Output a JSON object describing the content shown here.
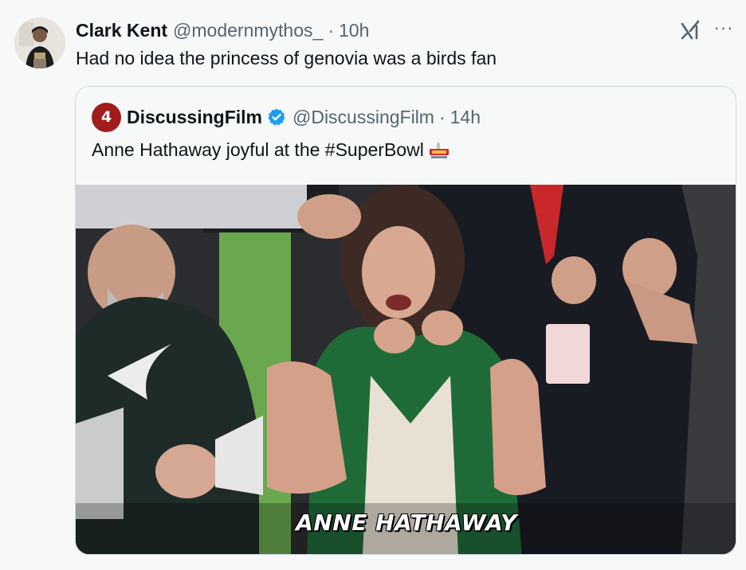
{
  "tweet": {
    "author_name": "Clark Kent",
    "author_handle": "@modernmythos_",
    "separator": "·",
    "time": "10h",
    "text": "Had no idea the princess of genovia was a birds fan",
    "more_label": "···"
  },
  "quote": {
    "avatar_text": "4",
    "author_name": "DiscussingFilm",
    "author_handle": "@DiscussingFilm",
    "separator": "·",
    "time": "14h",
    "text": "Anne Hathaway joyful at the #SuperBowl",
    "media_caption": "ANNE HATHAWAY"
  },
  "icons": {
    "grok": "grok-icon",
    "more": "more-icon",
    "verified": "verified-badge-icon",
    "superbowl": "super-bowl-lix-logo"
  },
  "colors": {
    "background": "#f7f9f9",
    "primary_text": "#0f1419",
    "secondary_text": "#536471",
    "border": "#cfd9de",
    "verified_blue": "#1d9bf0",
    "quote_avatar": "#a11d1d"
  }
}
